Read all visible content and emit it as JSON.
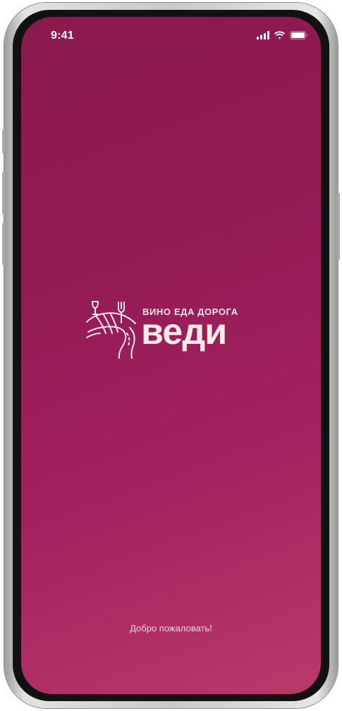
{
  "status_bar": {
    "time": "9:41",
    "icons": [
      "cellular-signal-icon",
      "wifi-icon",
      "battery-icon"
    ]
  },
  "logo": {
    "tagline": "ВИНО ЕДА ДОРОГА",
    "wordmark": "веди",
    "emblem": "vineyard-road-wine-fork-emblem"
  },
  "welcome_text": "Добро пожаловать!",
  "colors": {
    "background_top": "#8a1a4e",
    "background_bottom": "#b83a6a",
    "logo": "#fbe9e6",
    "text": "#ffffff"
  }
}
